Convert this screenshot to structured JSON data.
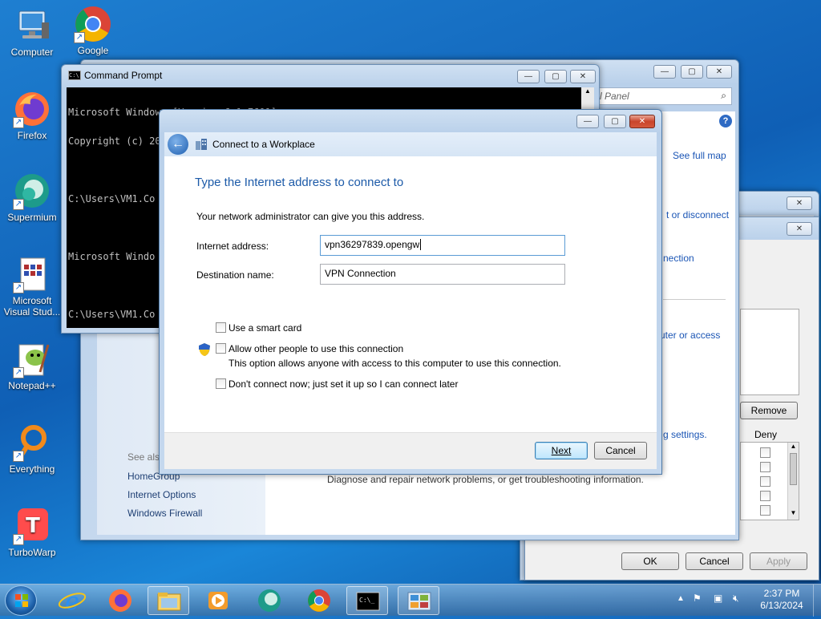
{
  "desktop": {
    "icons": [
      {
        "label": "Computer",
        "icon": "computer-icon"
      },
      {
        "label": "Google",
        "icon": "chrome-icon"
      },
      {
        "label": "Firefox",
        "icon": "firefox-icon"
      },
      {
        "label": "Supermium",
        "icon": "supermium-icon"
      },
      {
        "label": "Microsoft Visual Stud...",
        "icon": "visual-studio-icon"
      },
      {
        "label": "Notepad++",
        "icon": "notepadpp-icon"
      },
      {
        "label": "Everything",
        "icon": "everything-icon"
      },
      {
        "label": "TurboWarp",
        "icon": "turbowarp-icon"
      }
    ]
  },
  "cmd": {
    "title": "Command Prompt",
    "lines": [
      "Microsoft Windows [Version 6.1.7601]",
      "Copyright (c) 2009 Microsoft Corporation.  All rights reserved.",
      "",
      "C:\\Users\\VM1.Co",
      "",
      "Microsoft Windo",
      "",
      "C:\\Users\\VM1.Co"
    ]
  },
  "control_panel": {
    "search_placeholder": "l Panel",
    "links": {
      "see_full_map": "See full map",
      "connect_disconnect": "t or disconnect",
      "nection": "nection",
      "uter_or_access": "uter or access",
      "settings": "g settings.",
      "diagnose": "Diagnose and repair network problems, or get troubleshooting information."
    },
    "see_also": {
      "heading": "See also",
      "items": [
        "HomeGroup",
        "Internet Options",
        "Windows Firewall"
      ]
    }
  },
  "permissions": {
    "remove_label": "Remove",
    "deny_header": "Deny",
    "ok_label": "OK",
    "cancel_label": "Cancel",
    "apply_label": "Apply"
  },
  "wizard": {
    "title": "Connect to a Workplace",
    "heading": "Type the Internet address to connect to",
    "intro": "Your network administrator can give you this address.",
    "internet_address_label": "Internet address:",
    "internet_address_value": "vpn36297839.opengw",
    "destination_label": "Destination name:",
    "destination_value": "VPN Connection",
    "smart_card": "Use a smart card",
    "allow_others": "Allow other people to use this connection",
    "allow_others_note": "This option allows anyone with access to this computer to use this connection.",
    "dont_connect": "Don't connect now; just set it up so I can connect later",
    "next_label": "Next",
    "cancel_label": "Cancel"
  },
  "taskbar": {
    "time": "2:37 PM",
    "date": "6/13/2024"
  },
  "colors": {
    "heading_blue": "#1c5aa8",
    "link_blue": "#1a55b5"
  }
}
